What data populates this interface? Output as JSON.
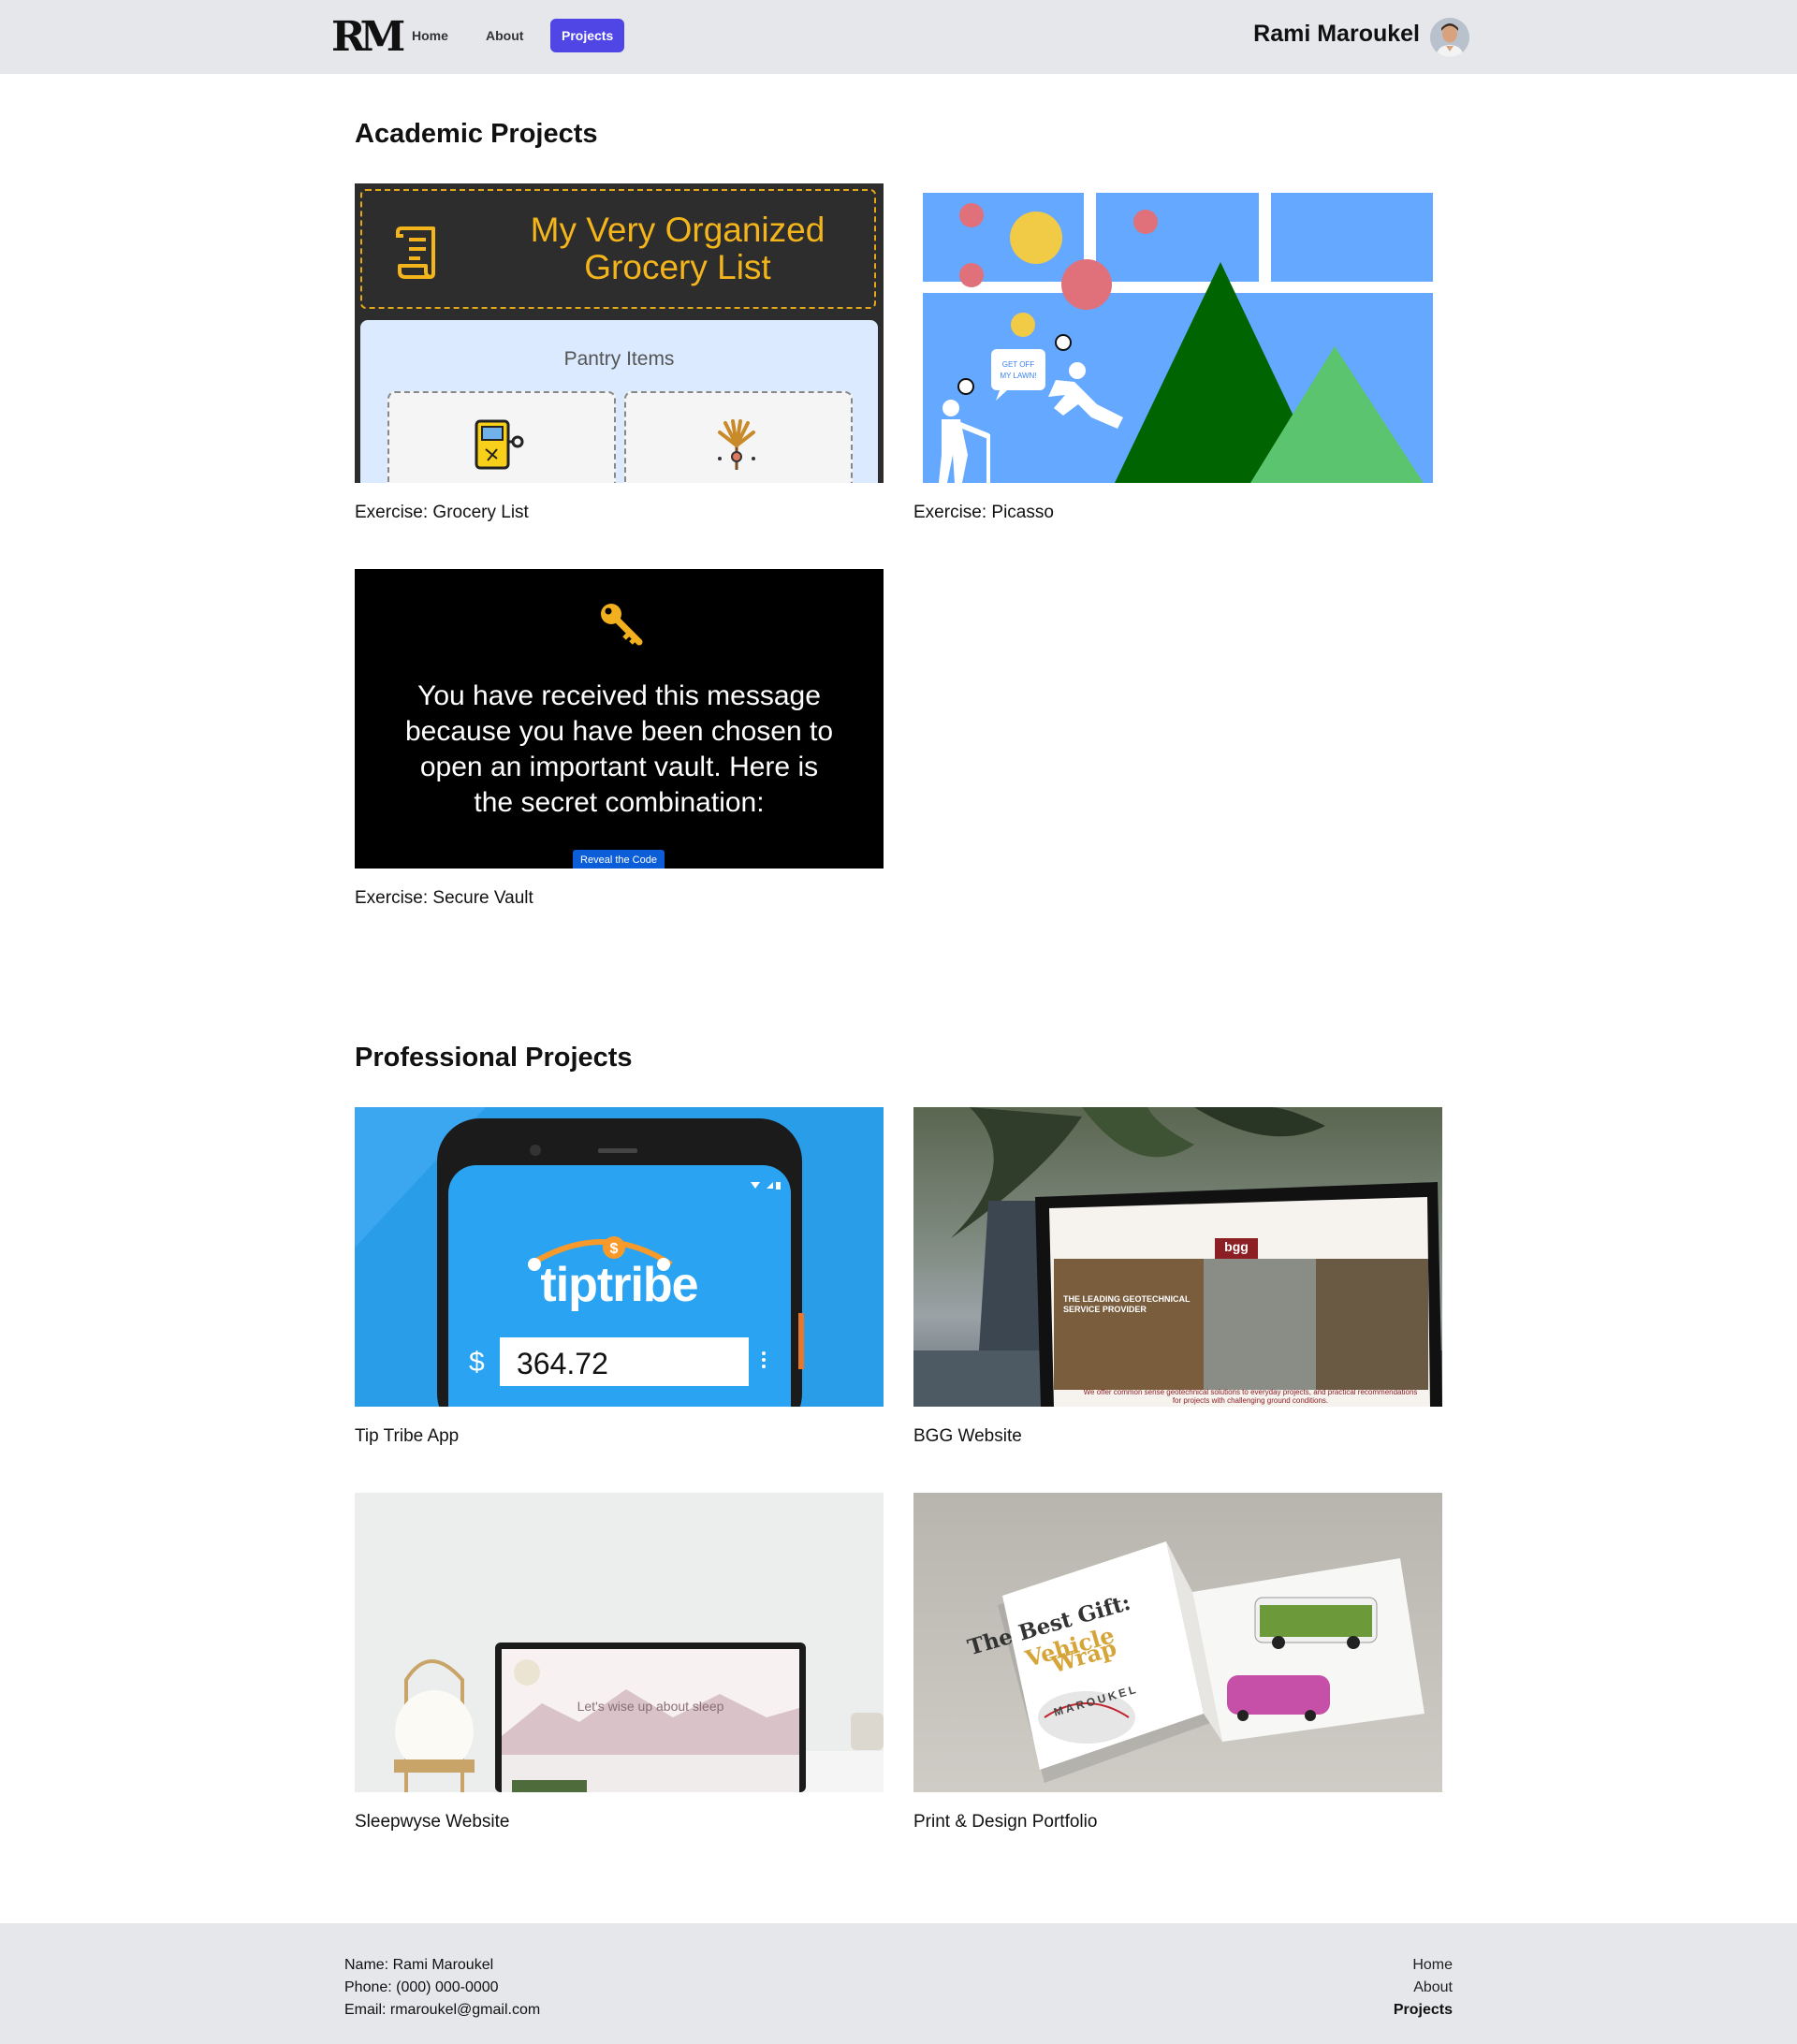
{
  "header": {
    "logo": "RM",
    "nav": [
      {
        "label": "Home",
        "active": false
      },
      {
        "label": "About",
        "active": false
      },
      {
        "label": "Projects",
        "active": true
      }
    ],
    "user_name": "Rami Maroukel",
    "accent": "#4f46e5"
  },
  "academic": {
    "title": "Academic Projects",
    "cards": [
      {
        "caption": "Exercise: Grocery List",
        "thumb": {
          "heading": "My Very Organized Grocery List",
          "subheading": "Pantry Items"
        }
      },
      {
        "caption": "Exercise: Picasso",
        "thumb": {
          "bubble": "GET OFF MY LAWN!"
        }
      },
      {
        "caption": "Exercise: Secure Vault",
        "thumb": {
          "message": "You have received this message because you have been chosen to open an important vault. Here is the secret combination:",
          "button": "Reveal the Code"
        }
      }
    ]
  },
  "professional": {
    "title": "Professional Projects",
    "cards": [
      {
        "caption": "Tip Tribe App",
        "thumb": {
          "brand": "tiptribe",
          "currency": "$",
          "amount": "364.72"
        }
      },
      {
        "caption": "BGG Website",
        "thumb": {
          "brand": "bgg",
          "headline": "THE LEADING GEOTECHNICAL SERVICE PROVIDER",
          "tagline": "We offer common sense geotechnical solutions to everyday projects, and practical recommendations for projects with challenging ground conditions."
        }
      },
      {
        "caption": "Sleepwyse Website",
        "thumb": {
          "headline": "Let's wise up about sleep"
        }
      },
      {
        "caption": "Print & Design Portfolio",
        "thumb": {
          "title_line1": "The Best Gift:",
          "title_line2": "Vehicle",
          "title_line3": "Wrap",
          "brand": "MAROUKEL"
        }
      }
    ]
  },
  "footer": {
    "name": "Name: Rami Maroukel",
    "phone": "Phone: (000) 000-0000",
    "email": "Email: rmaroukel@gmail.com",
    "nav": [
      "Home",
      "About",
      "Projects"
    ],
    "active": "Projects"
  }
}
